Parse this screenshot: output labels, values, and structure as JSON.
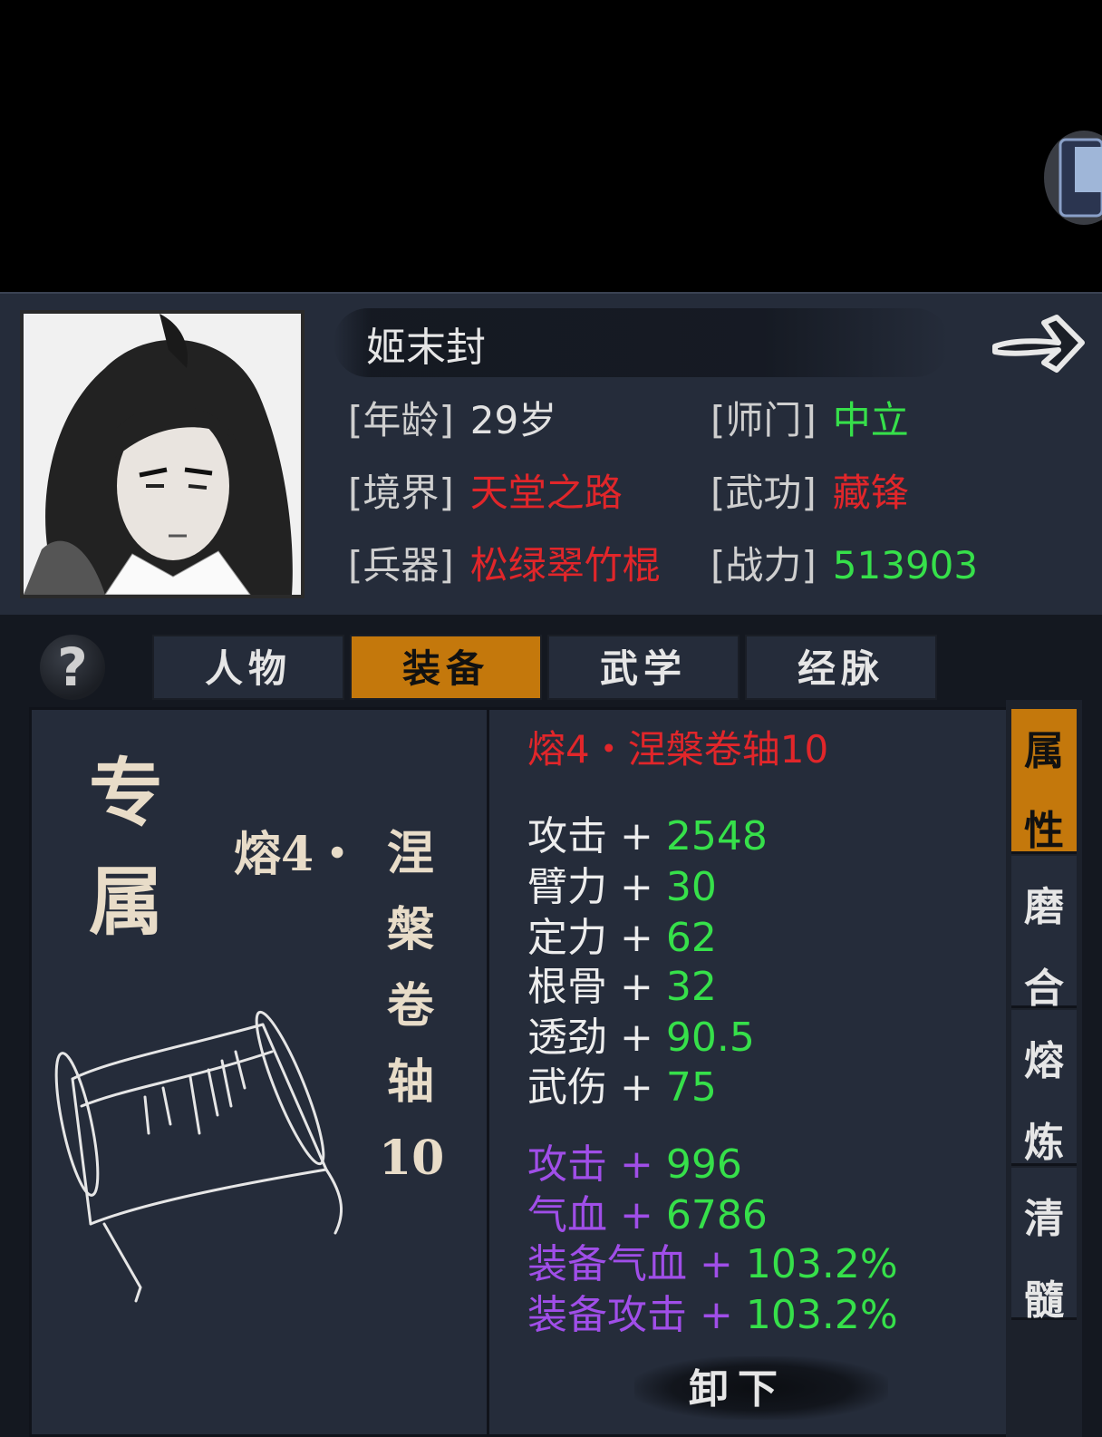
{
  "header": {
    "name": "姬末封",
    "rows": [
      {
        "label1": "[年龄]",
        "value1": "29岁",
        "label2": "[师门]",
        "value2": "中立"
      },
      {
        "label1": "[境界]",
        "value1": "天堂之路",
        "label2": "[武功]",
        "value2": "藏锋"
      },
      {
        "label1": "[兵器]",
        "value1": "松绿翠竹棍",
        "label2": "[战力]",
        "value2": "513903"
      }
    ]
  },
  "help": "?",
  "tabs": [
    "人物",
    "装备",
    "武学",
    "经脉"
  ],
  "left_card": {
    "exclusive_1": "专",
    "exclusive_2": "属",
    "item_prefix": "熔4・",
    "item_chars": [
      "涅",
      "槃",
      "卷",
      "轴",
      "10"
    ]
  },
  "right_card": {
    "title": "熔4・涅槃卷轴10",
    "stats": [
      {
        "name": "攻击",
        "plus": "+",
        "value": "2548"
      },
      {
        "name": "臂力",
        "plus": "+",
        "value": "30"
      },
      {
        "name": "定力",
        "plus": "+",
        "value": "62"
      },
      {
        "name": "根骨",
        "plus": "+",
        "value": "32"
      },
      {
        "name": "透劲",
        "plus": "+",
        "value": "90.5"
      },
      {
        "name": "武伤",
        "plus": "+",
        "value": "75"
      }
    ],
    "bonus_stats": [
      {
        "name": "攻击",
        "plus": "+",
        "value": "996"
      },
      {
        "name": "气血",
        "plus": "+",
        "value": "6786"
      },
      {
        "name": "装备气血",
        "plus": "+",
        "value": "103.2%"
      },
      {
        "name": "装备攻击",
        "plus": "+",
        "value": "103.2%"
      }
    ],
    "unequip": "卸下"
  },
  "side_tabs": [
    {
      "c1": "属",
      "c2": "性"
    },
    {
      "c1": "磨",
      "c2": "合"
    },
    {
      "c1": "熔",
      "c2": "炼"
    },
    {
      "c1": "清",
      "c2": "髓"
    }
  ],
  "colors": {
    "accent": "#c4780c",
    "red": "#e1262a",
    "green": "#36e04a",
    "purple": "#a04ee8",
    "panel": "#252c3a"
  }
}
